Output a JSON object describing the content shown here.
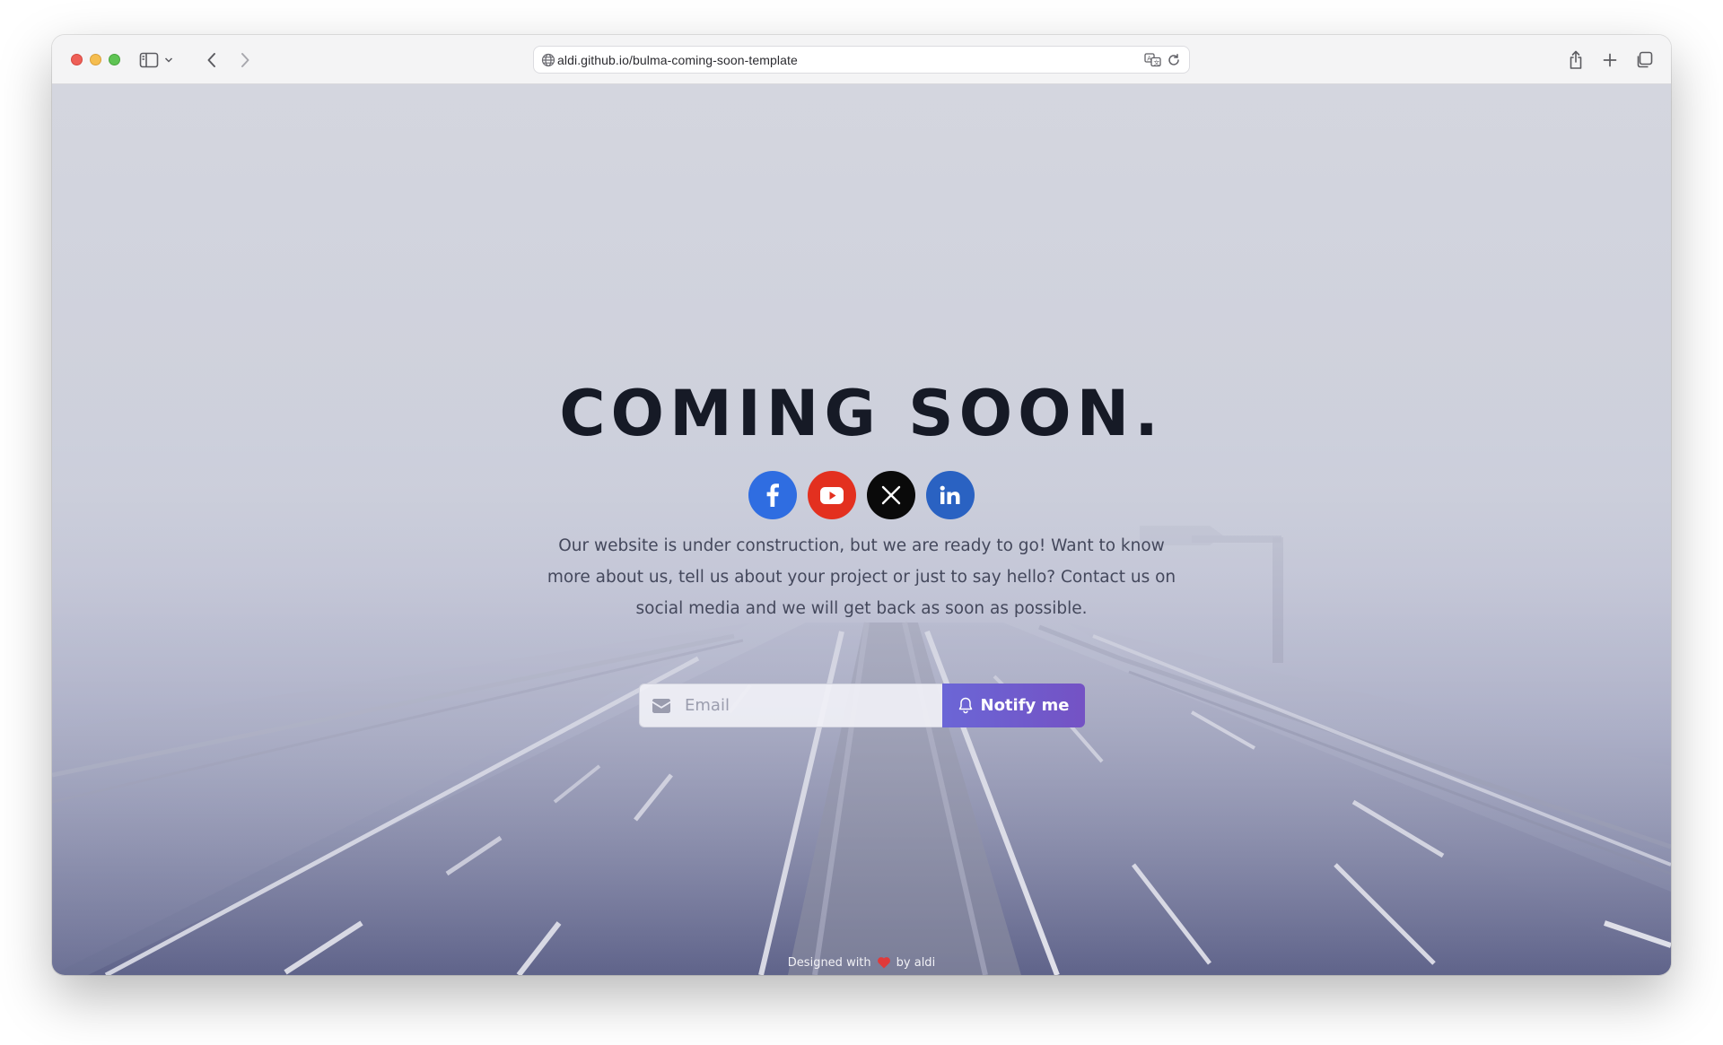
{
  "browser": {
    "url": "aldi.github.io/bulma-coming-soon-template"
  },
  "page": {
    "title": "COMING SOON.",
    "description": "Our website is under construction, but we are ready to go! Want to know more about us, tell us about your project or just to say hello? Contact us on social media and we will get back as soon as possible.",
    "email_placeholder": "Email",
    "notify_label": "Notify me",
    "social": [
      {
        "name": "facebook",
        "color": "#2f6de1"
      },
      {
        "name": "youtube",
        "color": "#e3301f"
      },
      {
        "name": "x",
        "color": "#0a0a0a"
      },
      {
        "name": "linkedin",
        "color": "#2a62c2"
      }
    ],
    "footer": {
      "prefix": "Designed with",
      "suffix": "by aldi",
      "heart_color": "#e03a3a"
    },
    "accent": "#6b5fd0"
  }
}
